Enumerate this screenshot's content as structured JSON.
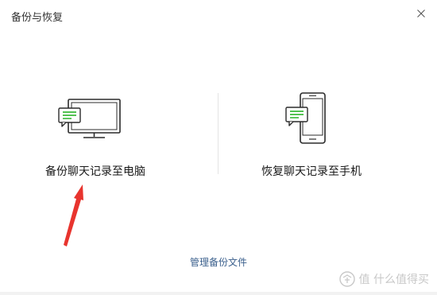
{
  "window": {
    "title": "备份与恢复",
    "close_icon": "close-icon"
  },
  "options": [
    {
      "label": "备份聊天记录至电脑",
      "icon": "computer-chat-icon"
    },
    {
      "label": "恢复聊天记录至手机",
      "icon": "phone-chat-icon"
    }
  ],
  "manage_link": "管理备份文件",
  "watermark": {
    "text": "值 什么值得买"
  },
  "colors": {
    "chat_bubble_green": "#1aad19",
    "link": "#3a5f8c",
    "annotation_arrow": "#e8342e"
  }
}
